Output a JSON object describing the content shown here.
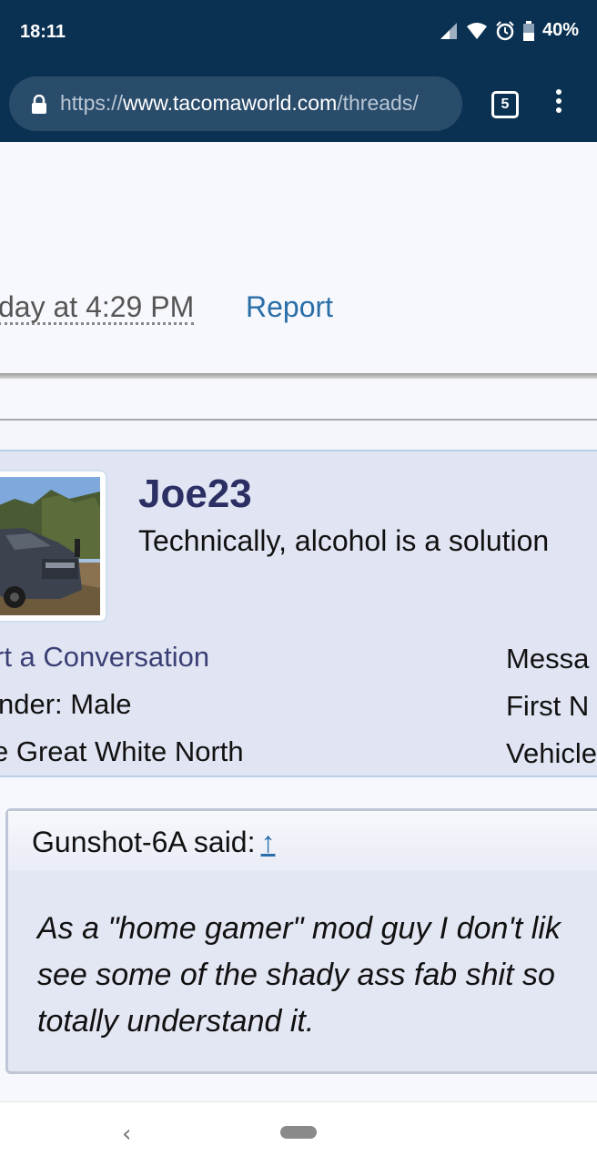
{
  "status": {
    "time": "18:11",
    "battery": "40%",
    "icons": [
      "signal-icon",
      "wifi-icon",
      "alarm-icon",
      "battery-icon"
    ]
  },
  "browser": {
    "url_scheme": "https://",
    "url_host": "www.tacomaworld.com",
    "url_path": "/threads/",
    "tab_count": "5"
  },
  "post": {
    "date": "day at 4:29 PM",
    "report_label": "Report"
  },
  "user": {
    "name": "Joe23",
    "title": "Technically, alcohol is a solution",
    "start_conversation": "rt a Conversation",
    "gender": "nder:  Male",
    "location": "e Great White North",
    "right_col": [
      "Messa",
      "First N",
      "Vehicle"
    ]
  },
  "quote": {
    "author": "Gunshot-6A said:",
    "arrow": "↑",
    "lines": [
      "As a \"home gamer\" mod guy I don't lik",
      "see some of the shady ass fab shit so",
      "totally understand it."
    ]
  },
  "colors": {
    "status_bar": "#0b3152",
    "link": "#2a6ea8",
    "username": "#2b2f63",
    "card_bg": "#e1e5f3"
  }
}
